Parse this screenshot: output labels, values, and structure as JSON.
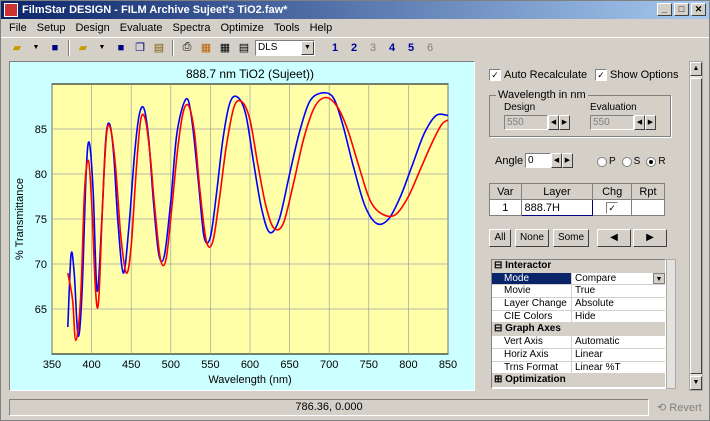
{
  "window": {
    "title": "FilmStar DESIGN - FILM Archive Sujeet's TiO2.faw*",
    "buttons": [
      "_",
      "□",
      "✕"
    ]
  },
  "menu": [
    "File",
    "Setup",
    "Design",
    "Evaluate",
    "Spectra",
    "Optimize",
    "Tools",
    "Help"
  ],
  "toolbar": {
    "icons": [
      "open-folder-icon",
      "save-icon",
      "open-folder-icon",
      "save-icon",
      "copy-icon",
      "paste-icon",
      "print-icon",
      "chart-icon",
      "table-icon",
      "report-icon"
    ],
    "combo_value": "DLS",
    "numbers": [
      "1",
      "2",
      "3",
      "4",
      "5",
      "6"
    ],
    "disabled_numbers": [
      "3",
      "6"
    ]
  },
  "chart_data": {
    "type": "line",
    "title": "888.7 nm TiO2 (Sujeet))",
    "xlabel": "Wavelength (nm)",
    "ylabel": "% Transmittance",
    "xlim": [
      350,
      850
    ],
    "ylim": [
      60,
      90
    ],
    "xticks": [
      "350",
      "400",
      "450",
      "500",
      "550",
      "600",
      "650",
      "700",
      "750",
      "800",
      "850"
    ],
    "yticks": [
      "65",
      "70",
      "75",
      "80",
      "85"
    ],
    "grid": true,
    "series": [
      {
        "color": "#0000ff",
        "x": [
          370,
          374,
          378,
          383,
          388,
          393,
          397,
          402,
          407,
          413,
          418,
          423,
          428,
          433,
          440,
          447,
          454,
          460,
          466,
          472,
          478,
          485,
          492,
          500,
          507,
          515,
          522,
          528,
          535,
          542,
          550,
          558,
          566,
          575,
          585,
          595,
          605,
          615,
          625,
          637,
          650,
          662,
          675,
          690,
          705,
          717,
          730,
          745,
          760,
          775,
          790,
          805,
          820,
          835,
          850
        ],
        "y": [
          63,
          71,
          69,
          62,
          67,
          80,
          83.5,
          78,
          67,
          75,
          84,
          85.5,
          82,
          75,
          69,
          74,
          82,
          86.5,
          87.3,
          84,
          77,
          71,
          71,
          77,
          84,
          87.5,
          88.2,
          85,
          79,
          73,
          73,
          78,
          84,
          88,
          88.5,
          86.5,
          81,
          76,
          73.5,
          75,
          80,
          84.5,
          88,
          89,
          88.5,
          85.5,
          81,
          76.5,
          74.5,
          75,
          77.5,
          81,
          84.5,
          86.5,
          86.5
        ]
      },
      {
        "color": "#ff0000",
        "x": [
          370,
          376,
          380,
          386,
          391,
          396,
          400,
          405,
          409,
          414,
          419,
          424,
          430,
          437,
          444,
          450,
          456,
          462,
          468,
          474,
          480,
          487,
          494,
          501,
          509,
          516,
          523,
          530,
          537,
          545,
          553,
          561,
          570,
          580,
          590,
          600,
          610,
          620,
          630,
          642,
          655,
          668,
          682,
          696,
          710,
          723,
          737,
          752,
          768,
          784,
          800,
          815,
          830,
          842,
          850
        ],
        "y": [
          69,
          66,
          61.5,
          66,
          78,
          81.5,
          77,
          67,
          66,
          77,
          84.5,
          85,
          81,
          73,
          69,
          72,
          80,
          86,
          86,
          82,
          76,
          70.5,
          70.5,
          76,
          83,
          87,
          87.5,
          84.5,
          78,
          72.5,
          72.5,
          77,
          83,
          87.5,
          88,
          86,
          81,
          76.5,
          74,
          74.5,
          79,
          84,
          87.5,
          88.5,
          87.5,
          85,
          81,
          77,
          75.5,
          75.5,
          77.5,
          80.5,
          83.5,
          85.5,
          86
        ]
      }
    ]
  },
  "right": {
    "auto_recalc": "Auto Recalculate",
    "show_options": "Show Options",
    "wavelength_group": "Wavelength in nm",
    "design_label": "Design",
    "design_value": "550",
    "evaluation_label": "Evaluation",
    "evaluation_value": "550",
    "angle_label": "Angle",
    "angle_value": "0",
    "pol": [
      "P",
      "S",
      "R"
    ],
    "table_headers": [
      "Var",
      "Layer",
      "Chg",
      "Rpt"
    ],
    "table_row": {
      "var": "1",
      "layer": "888.7H"
    },
    "buttons": [
      "All",
      "None",
      "Some"
    ],
    "props": [
      {
        "cat": true,
        "k": "Interactor"
      },
      {
        "k": "Mode",
        "v": "Compare",
        "sel": true
      },
      {
        "k": "Movie",
        "v": "True"
      },
      {
        "k": "Layer Change",
        "v": "Absolute"
      },
      {
        "k": "CIE Colors",
        "v": "Hide"
      },
      {
        "cat": true,
        "k": "Graph Axes"
      },
      {
        "k": "Vert Axis",
        "v": "Automatic"
      },
      {
        "k": "Horiz Axis",
        "v": "Linear"
      },
      {
        "k": "Trns Format",
        "v": "Linear %T"
      },
      {
        "cat": true,
        "k": "Optimization",
        "plus": true
      }
    ]
  },
  "status": {
    "coords": "786.36, 0.000",
    "revert": "Revert"
  }
}
